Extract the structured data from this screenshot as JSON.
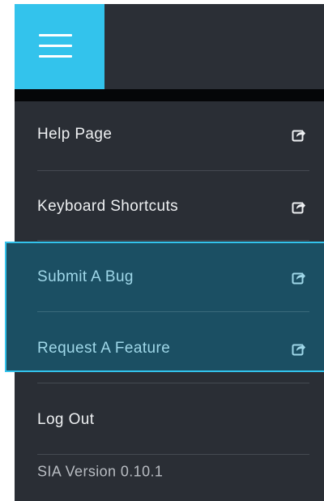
{
  "menu": {
    "toggle_icon": "hamburger-icon",
    "items": [
      {
        "label": "Help Page",
        "icon": "external-link-icon"
      },
      {
        "label": "Keyboard Shortcuts",
        "icon": "external-link-icon"
      },
      {
        "label": "Submit A Bug",
        "icon": "external-link-icon"
      },
      {
        "label": "Request A Feature",
        "icon": "external-link-icon"
      },
      {
        "label": "Log Out"
      }
    ],
    "version": "SIA Version 0.10.1"
  },
  "colors": {
    "accent": "#33c3ec",
    "panel_bg": "#2a2e35",
    "highlight_bg": "#1b4f63",
    "text": "#eef0f2",
    "highlight_text": "#9fd7e8"
  }
}
